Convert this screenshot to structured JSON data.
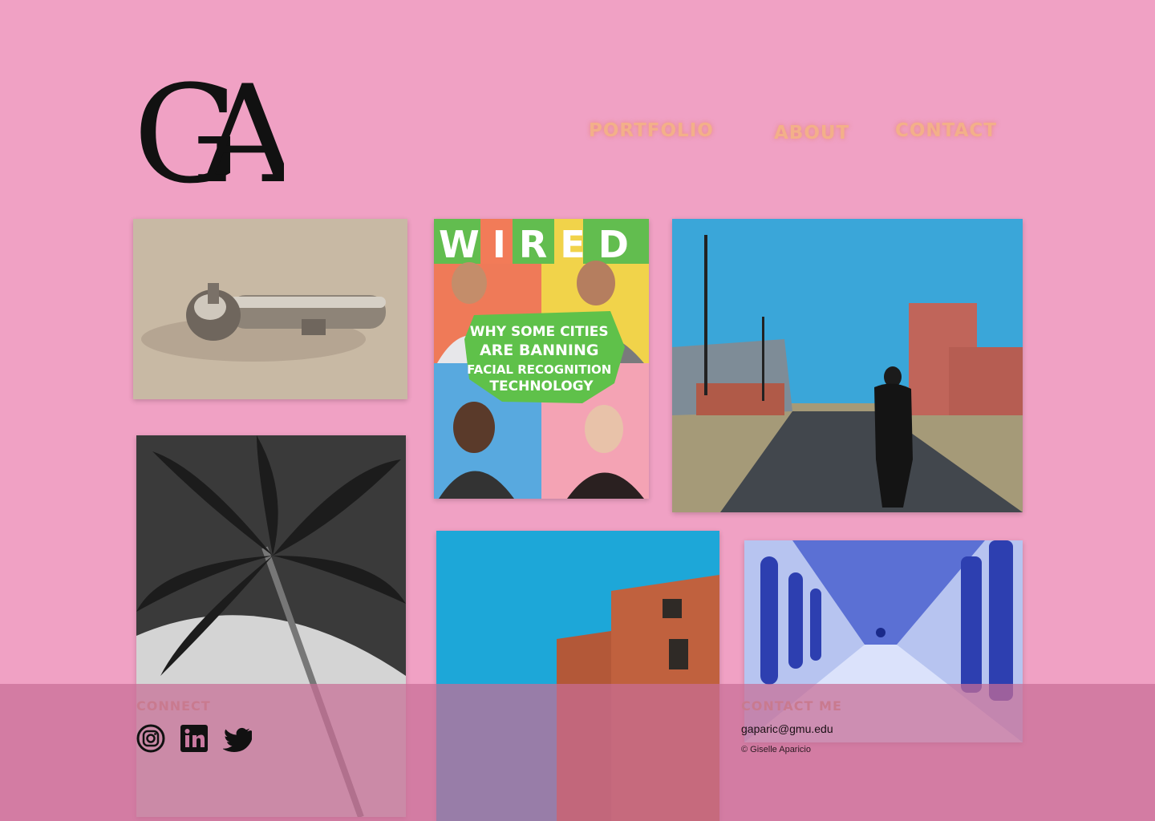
{
  "logo": {
    "text": "GA"
  },
  "nav": [
    {
      "label": "PORTFOLIO"
    },
    {
      "label": "ABOUT"
    },
    {
      "label": "CONTACT"
    }
  ],
  "gallery": {
    "wired": {
      "masthead": [
        "W",
        "I",
        "R",
        "E",
        "D"
      ],
      "headline_lines": [
        "WHY SOME CITIES",
        "ARE BANNING",
        "FACIAL RECOGNITION",
        "TECHNOLOGY"
      ]
    }
  },
  "footer": {
    "connect_title": "CONNECT",
    "social_icons": [
      "instagram-icon",
      "linkedin-icon",
      "twitter-icon"
    ],
    "contact_title": "CONTACT ME",
    "email": "gaparic@gmu.edu",
    "copyright": "© Giselle Aparicio"
  },
  "colors": {
    "background": "#f0a1c4",
    "nav_text": "#f3b089",
    "footer_overlay": "#c86e96"
  }
}
